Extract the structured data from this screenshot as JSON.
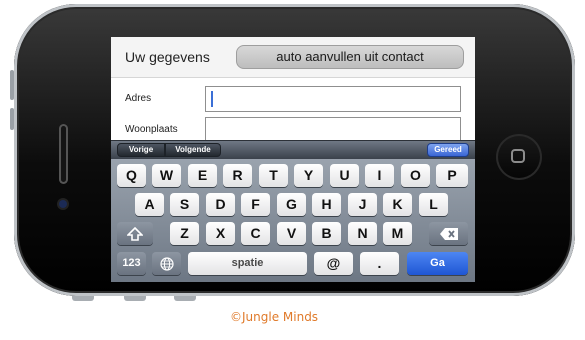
{
  "form": {
    "header_label": "Uw gegevens",
    "autofill_button": "auto aanvullen uit contact",
    "fields": [
      {
        "label": "Adres",
        "value": ""
      },
      {
        "label": "Woonplaats",
        "value": ""
      }
    ]
  },
  "toolbar": {
    "prev_label": "Vorige",
    "next_label": "Volgende",
    "done_label": "Gereed"
  },
  "keyboard": {
    "row1": [
      "Q",
      "W",
      "E",
      "R",
      "T",
      "Y",
      "U",
      "I",
      "O",
      "P"
    ],
    "row2": [
      "A",
      "S",
      "D",
      "F",
      "G",
      "H",
      "J",
      "K",
      "L"
    ],
    "row3": [
      "Z",
      "X",
      "C",
      "V",
      "B",
      "N",
      "M"
    ],
    "numbers_label": "123",
    "space_label": "spatie",
    "at_label": "@",
    "dot_label": ".",
    "go_label": "Ga",
    "icons": [
      "shift-icon",
      "backspace-icon",
      "globe-icon"
    ]
  },
  "credit": "©Jungle Minds",
  "colors": {
    "go_key": "#1f56d4",
    "done_button": "#3a66d6",
    "credit_text": "#e07a2a"
  }
}
